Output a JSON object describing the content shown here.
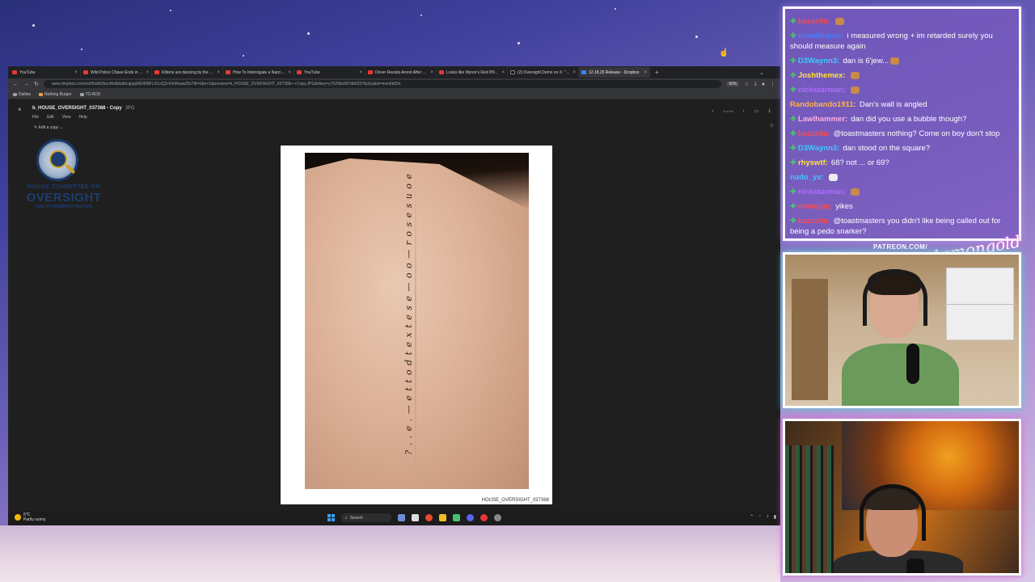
{
  "browser": {
    "tabs": [
      {
        "label": "YouTube",
        "icon": "youtube-icon"
      },
      {
        "label": "Wild Police Chase Ends in Crash",
        "icon": "youtube-icon"
      },
      {
        "label": "Kittens are dancing by the trash",
        "icon": "youtube-icon"
      },
      {
        "label": "How To Interrogate a Narcissist",
        "icon": "youtube-icon"
      },
      {
        "label": "YouTube",
        "icon": "youtube-icon"
      },
      {
        "label": "Driver Resists Arrest After Refusing",
        "icon": "youtube-icon"
      },
      {
        "label": "Looks like Mynor's Red Pill video",
        "icon": "youtube-icon"
      },
      {
        "label": "(2) Oversight Dems on X: \"NEW\"",
        "icon": "x-icon"
      },
      {
        "label": "12.18.25 Release - Dropbox",
        "icon": "dropbox-icon"
      }
    ],
    "url": "www.dropbox.com/scl/fo/d62bochkdbdalbcqpgd/ADRBFLD1oQ2rXimNaaa25s?dl=0&e=1&preview=b_HOUSE_OVERSIGHT_037368+-+Copy.JPG&rlkey=y7529bs967db6257fp3yu&st=mxn6k82e",
    "zoom": "90%",
    "bookmarks": [
      "Dailies",
      "Nothing Burger",
      "TO ADD"
    ]
  },
  "dropbox": {
    "file_title": "b_HOUSE_OVERSIGHT_037368 - Copy",
    "file_ext": "JPG",
    "menu": [
      "File",
      "Edit",
      "View",
      "Help"
    ],
    "edit_copy": "Edit a copy",
    "pager": "6 of 66"
  },
  "document": {
    "logo_line1": "HOUSE COMMITTEE ON",
    "logo_line2": "OVERSIGHT",
    "logo_line3": "AND GOVERNMENT REFORM",
    "tattoo_text": "? . . e . — e t t o d t e x t e s e — o o — r o s e s u o e",
    "bates": "HOUSE_OVERSIGHT_037368"
  },
  "taskbar": {
    "temp": "6°C",
    "weather": "Partly sunny",
    "search": "Search"
  },
  "chat": {
    "messages": [
      {
        "user": "bazzella:",
        "text": "",
        "color": "#ff4a4a"
      },
      {
        "user": "mowlitopoo:",
        "text": "i measured wrong + im retarded surely you should measure again",
        "color": "#4a7dff"
      },
      {
        "user": "D3Waynn3:",
        "text": "dan is 6'jew...",
        "color": "#3ec8ff"
      },
      {
        "user": "Joshthemex:",
        "text": "",
        "color": "#ffe23e"
      },
      {
        "user": "nickstarman:",
        "text": "",
        "color": "#b06cff"
      },
      {
        "user": "Randobando1911:",
        "text": "Dan's wall is angled",
        "color": "#ffb347"
      },
      {
        "user": "Lawlhammer:",
        "text": "dan did you use a bubble though?",
        "color": "#ffb0e0"
      },
      {
        "user": "bazzella:",
        "text": "@toastmasters nothing? Come on boy don't stop",
        "color": "#ff4a4a"
      },
      {
        "user": "D3Waynn3:",
        "text": "dan stood on the square?",
        "color": "#3ec8ff"
      },
      {
        "user": "rhyswtf:",
        "text": "68? not ... or 69?",
        "color": "#ffe23e"
      },
      {
        "user": "nado_yv:",
        "text": "",
        "color": "#3ec8ff"
      },
      {
        "user": "nickstarman:",
        "text": "",
        "color": "#b06cff"
      },
      {
        "user": "metaguy:",
        "text": "yikes",
        "color": "#ff4a4a"
      },
      {
        "user": "bazzella:",
        "text": "@toastmasters you didn't like being called out for being a pedo snarker?",
        "color": "#ff4a4a"
      }
    ]
  },
  "overlay": {
    "patreon": "PATREON.COM/",
    "signature": "Asmongold"
  }
}
